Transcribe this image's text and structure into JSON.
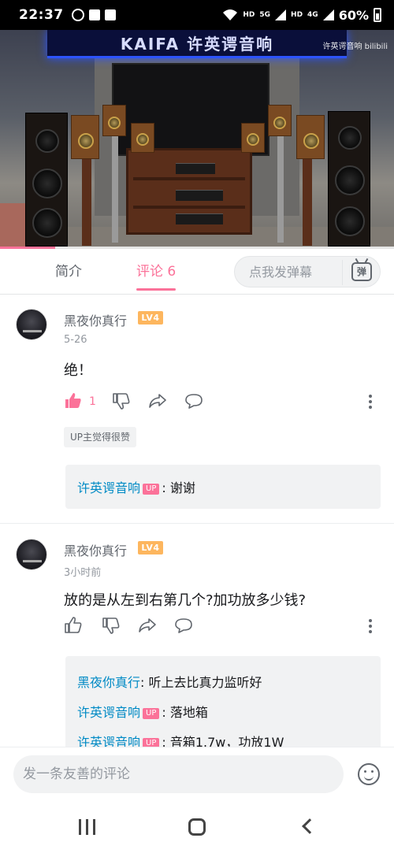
{
  "status_bar": {
    "time": "22:37",
    "signal_label_1": "HD",
    "signal_label_2": "HD",
    "network_1": "5G",
    "network_2": "4G",
    "battery": "60%"
  },
  "video": {
    "banner_text": "KAIFA 许英谔音响",
    "watermark": "许英谔音响 bilibili",
    "progress": 0.14
  },
  "tabs": {
    "intro_label": "简介",
    "comment_label": "评论",
    "comment_count": "6",
    "danmaku_placeholder": "点我发弹幕",
    "danmaku_button": "弹"
  },
  "comments": [
    {
      "username": "黑夜你真行",
      "level": "LV4",
      "date": "5-26",
      "text": "绝！",
      "likes": "1",
      "liked": true,
      "up_liked_badge": "UP主觉得很赞",
      "replies": [
        {
          "name": "许英谔音响",
          "is_up": true,
          "up_tag": "UP",
          "sep": ":",
          "text": "谢谢"
        }
      ]
    },
    {
      "username": "黑夜你真行",
      "level": "LV4",
      "date": "3小时前",
      "text": "放的是从左到右第几个?加功放多少钱?",
      "replies": [
        {
          "name": "黑夜你真行",
          "sep": ":",
          "text": "听上去比真力监听好"
        },
        {
          "name": "许英谔音响",
          "is_up": true,
          "up_tag": "UP",
          "sep": ":",
          "text": "落地箱"
        },
        {
          "name": "许英谔音响",
          "is_up": true,
          "up_tag": "UP",
          "sep": ":",
          "text": "音箱1.7w，功放1W"
        }
      ]
    }
  ],
  "bottom_bar": {
    "comment_placeholder": "发一条友善的评论"
  },
  "colors": {
    "accent_pink": "#fb7299",
    "reply_name_blue": "#008ac5",
    "level_orange": "#fdb65e"
  }
}
